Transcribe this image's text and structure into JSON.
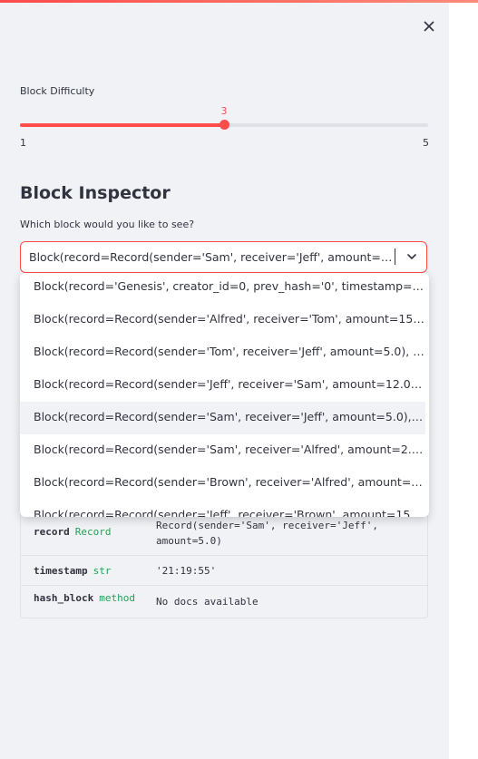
{
  "sidebar": {
    "difficulty": {
      "label": "Block Difficulty",
      "value": 3,
      "value_text": "3",
      "min": 1,
      "max": 5,
      "min_text": "1",
      "max_text": "5",
      "accent": "#ff4b4b"
    },
    "inspector": {
      "title": "Block Inspector",
      "select_label": "Which block would you like to see?",
      "selected": "Block(record=Record(sender='Sam', receiver='Jeff', amount=5.0),...",
      "options": [
        "Block(record='Genesis', creator_id=0, prev_hash='0', timestamp='2...",
        "Block(record=Record(sender='Alfred', receiver='Tom', amount=15.0)...",
        "Block(record=Record(sender='Tom', receiver='Jeff', amount=5.0), cr...",
        "Block(record=Record(sender='Jeff', receiver='Sam', amount=12.0), c...",
        "Block(record=Record(sender='Sam', receiver='Jeff', amount=5.0), cr...",
        "Block(record=Record(sender='Sam', receiver='Alfred', amount=2.0), ...",
        "Block(record=Record(sender='Brown', receiver='Alfred', amount=5....",
        "Block(record=Record(sender='Jeff', receiver='Brown', amount=15.0)..."
      ],
      "active_option_index": 4
    },
    "details": {
      "rows": [
        {
          "key": "record",
          "type": "Record",
          "value": "Record(sender='Sam', receiver='Jeff', amount=5.0)"
        },
        {
          "key": "timestamp",
          "type": "str",
          "value": "'21:19:55'"
        },
        {
          "key": "hash_block",
          "type": "method",
          "value": "No docs available"
        }
      ]
    }
  },
  "colors": {
    "sidebar_bg": "#f0f2f6",
    "type_green": "#21a354"
  },
  "icons": {
    "close": "close-icon",
    "chevron": "chevron-down-icon"
  }
}
